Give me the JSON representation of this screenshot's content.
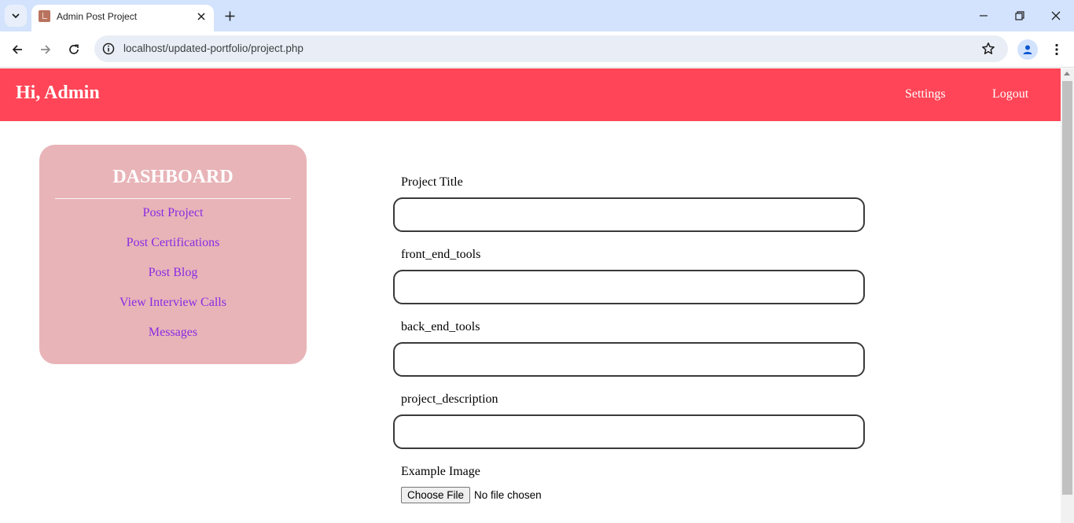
{
  "browser": {
    "tab_title": "Admin Post Project",
    "url": "localhost/updated-portfolio/project.php",
    "icons": [
      "tab-search-icon",
      "close-icon",
      "plus-icon",
      "minimize-icon",
      "restore-icon",
      "window-close-icon",
      "back-arrow-icon",
      "forward-arrow-icon",
      "reload-icon",
      "site-info-icon",
      "bookmark-star-icon",
      "profile-icon",
      "kebab-menu-icon"
    ]
  },
  "header": {
    "greeting": "Hi, Admin",
    "links": [
      "Settings",
      "Logout"
    ],
    "background": "#ff4557"
  },
  "sidebar": {
    "title": "DASHBOARD",
    "items": [
      "Post Project",
      "Post Certifications",
      "Post Blog",
      "View Interview Calls",
      "Messages"
    ],
    "background": "#e8b4b8",
    "link_color": "#8a2be2"
  },
  "form": {
    "fields": [
      {
        "label": "Project Title",
        "value": ""
      },
      {
        "label": "front_end_tools",
        "value": ""
      },
      {
        "label": "back_end_tools",
        "value": ""
      },
      {
        "label": "project_description",
        "value": ""
      }
    ],
    "image_label": "Example Image",
    "file_button": "Choose File",
    "file_status": "No file chosen"
  }
}
